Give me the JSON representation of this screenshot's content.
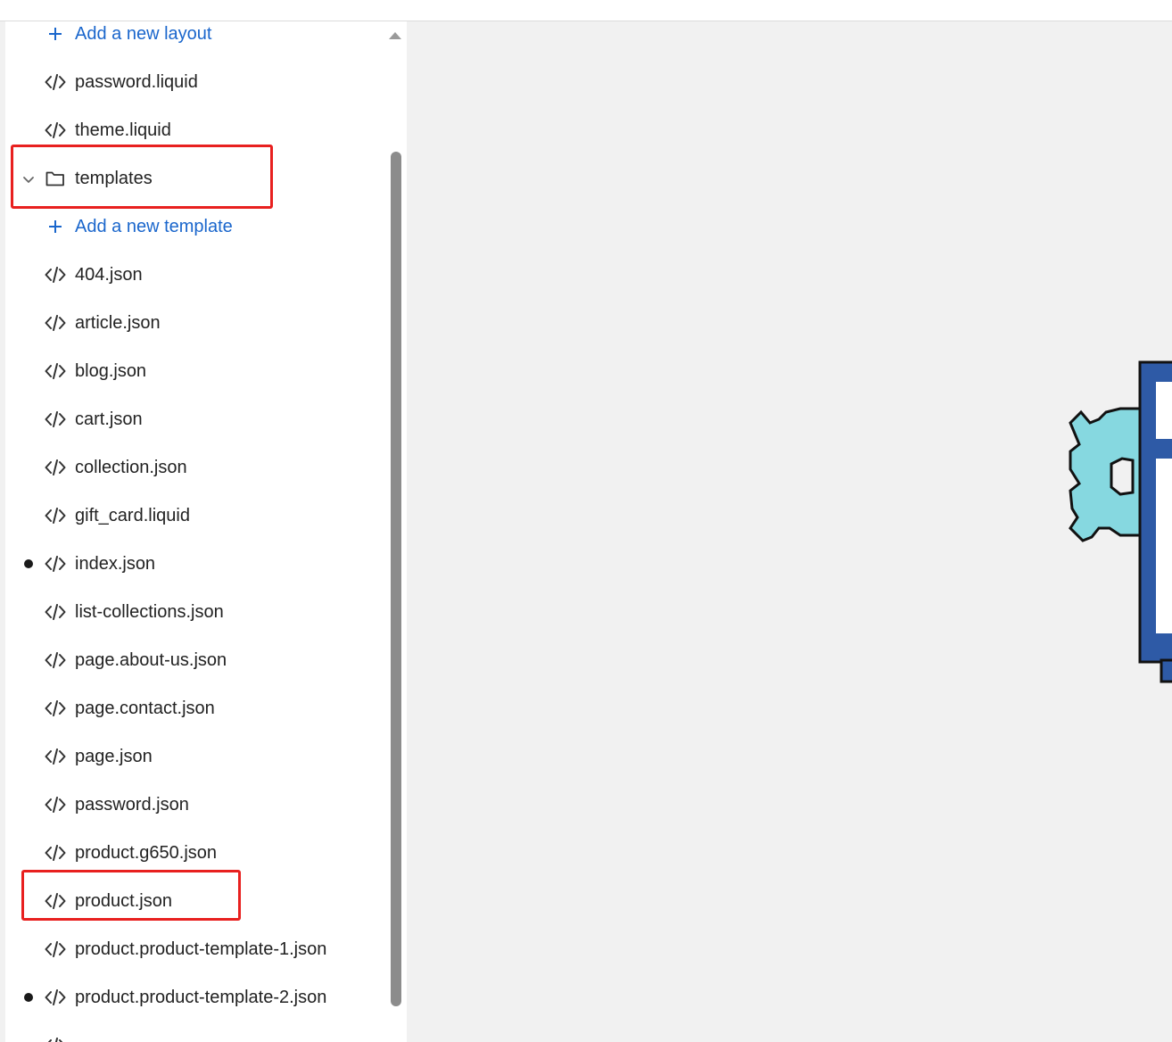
{
  "file_tree": {
    "layout_add_label": "Add a new layout",
    "layout_files": [
      "password.liquid",
      "theme.liquid"
    ],
    "templates_folder": {
      "label": "templates",
      "add_label": "Add a new template",
      "files": [
        {
          "name": "404.json",
          "modified": false
        },
        {
          "name": "article.json",
          "modified": false
        },
        {
          "name": "blog.json",
          "modified": false
        },
        {
          "name": "cart.json",
          "modified": false
        },
        {
          "name": "collection.json",
          "modified": false
        },
        {
          "name": "gift_card.liquid",
          "modified": false
        },
        {
          "name": "index.json",
          "modified": true
        },
        {
          "name": "list-collections.json",
          "modified": false
        },
        {
          "name": "page.about-us.json",
          "modified": false
        },
        {
          "name": "page.contact.json",
          "modified": false
        },
        {
          "name": "page.json",
          "modified": false
        },
        {
          "name": "password.json",
          "modified": false
        },
        {
          "name": "product.g650.json",
          "modified": false
        },
        {
          "name": "product.json",
          "modified": false
        },
        {
          "name": "product.product-template-1.json",
          "modified": false
        },
        {
          "name": "product.product-template-2.json",
          "modified": true
        }
      ]
    }
  },
  "icons": {
    "file": "code-file-icon",
    "folder": "folder-icon",
    "add": "plus-icon",
    "expand": "chevron-down-icon"
  },
  "colors": {
    "link": "#1a66cc",
    "highlight": "#e8201f",
    "canvas": "#f1f1f1"
  }
}
